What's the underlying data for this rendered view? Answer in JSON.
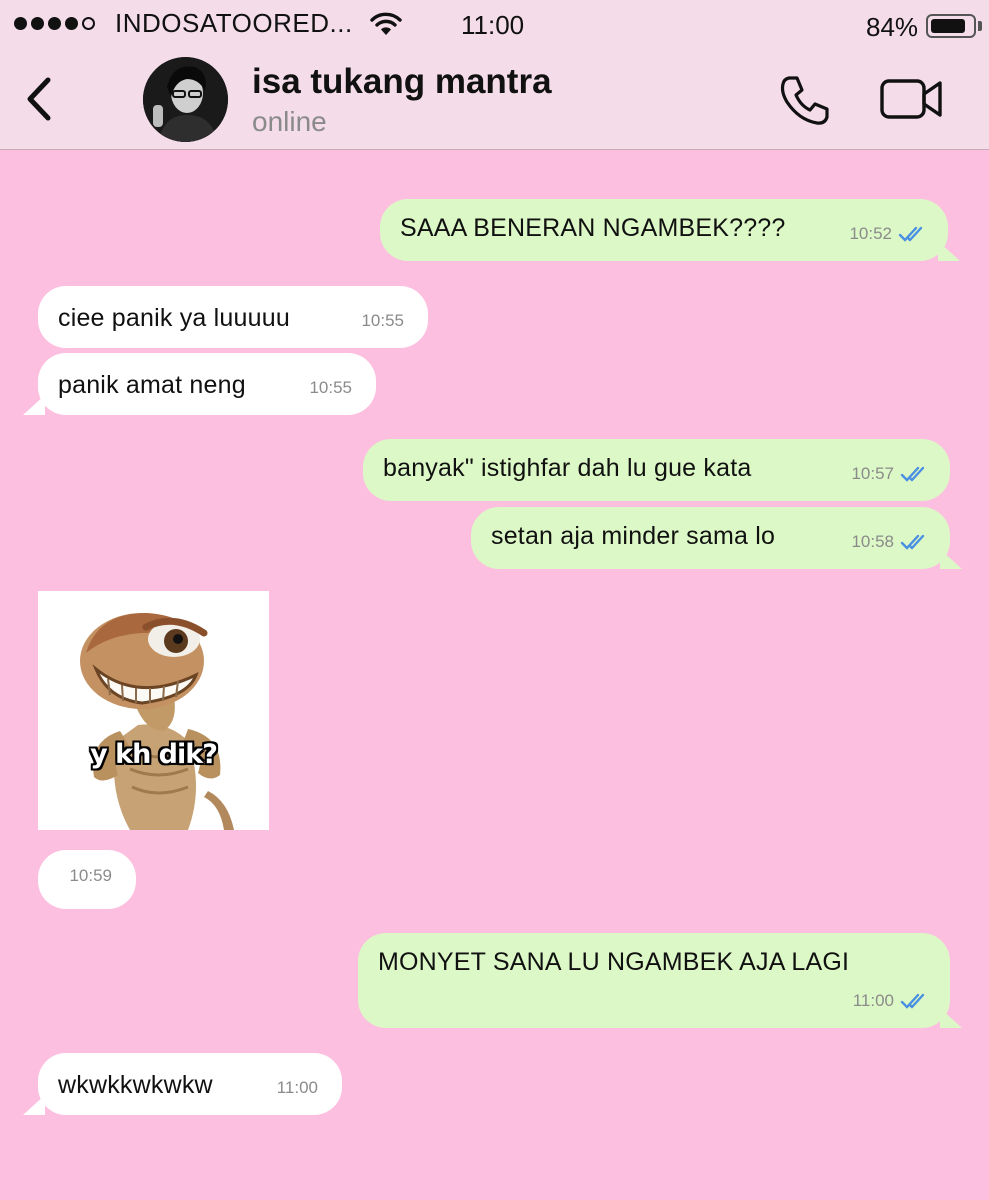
{
  "status_bar": {
    "carrier": "INDOSATOORED...",
    "time": "11:00",
    "battery_percent_label": "84%",
    "battery_level": 0.84,
    "signal_bars_filled": 4,
    "signal_bars_total": 5
  },
  "header": {
    "contact_name": "isa tukang mantra",
    "contact_status": "online",
    "icons": [
      "back-chevron-icon",
      "phone-icon",
      "video-camera-icon"
    ]
  },
  "colors": {
    "chat_background": "#fdbfe0",
    "header_background": "#f4dde9",
    "outgoing_bubble": "#dcf8c6",
    "incoming_bubble": "#ffffff",
    "read_tick": "#4a90e2"
  },
  "messages": [
    {
      "direction": "out",
      "text": "SAAA BENERAN NGAMBEK????",
      "time": "10:52",
      "read": true
    },
    {
      "direction": "in",
      "text": "ciee panik ya luuuuu",
      "time": "10:55"
    },
    {
      "direction": "in",
      "text": "panik amat neng",
      "time": "10:55"
    },
    {
      "direction": "out",
      "text": "banyak\" istighfar dah lu gue kata",
      "time": "10:57",
      "read": true
    },
    {
      "direction": "out",
      "text": "setan aja minder sama lo",
      "time": "10:58",
      "read": true
    },
    {
      "direction": "in",
      "type": "sticker",
      "caption": "y kh dik?",
      "time": "10:59"
    },
    {
      "direction": "out",
      "text": "MONYET SANA LU NGAMBEK AJA LAGI",
      "time": "11:00",
      "read": true
    },
    {
      "direction": "in",
      "text": "wkwkkwkwkw",
      "time": "11:00"
    }
  ]
}
